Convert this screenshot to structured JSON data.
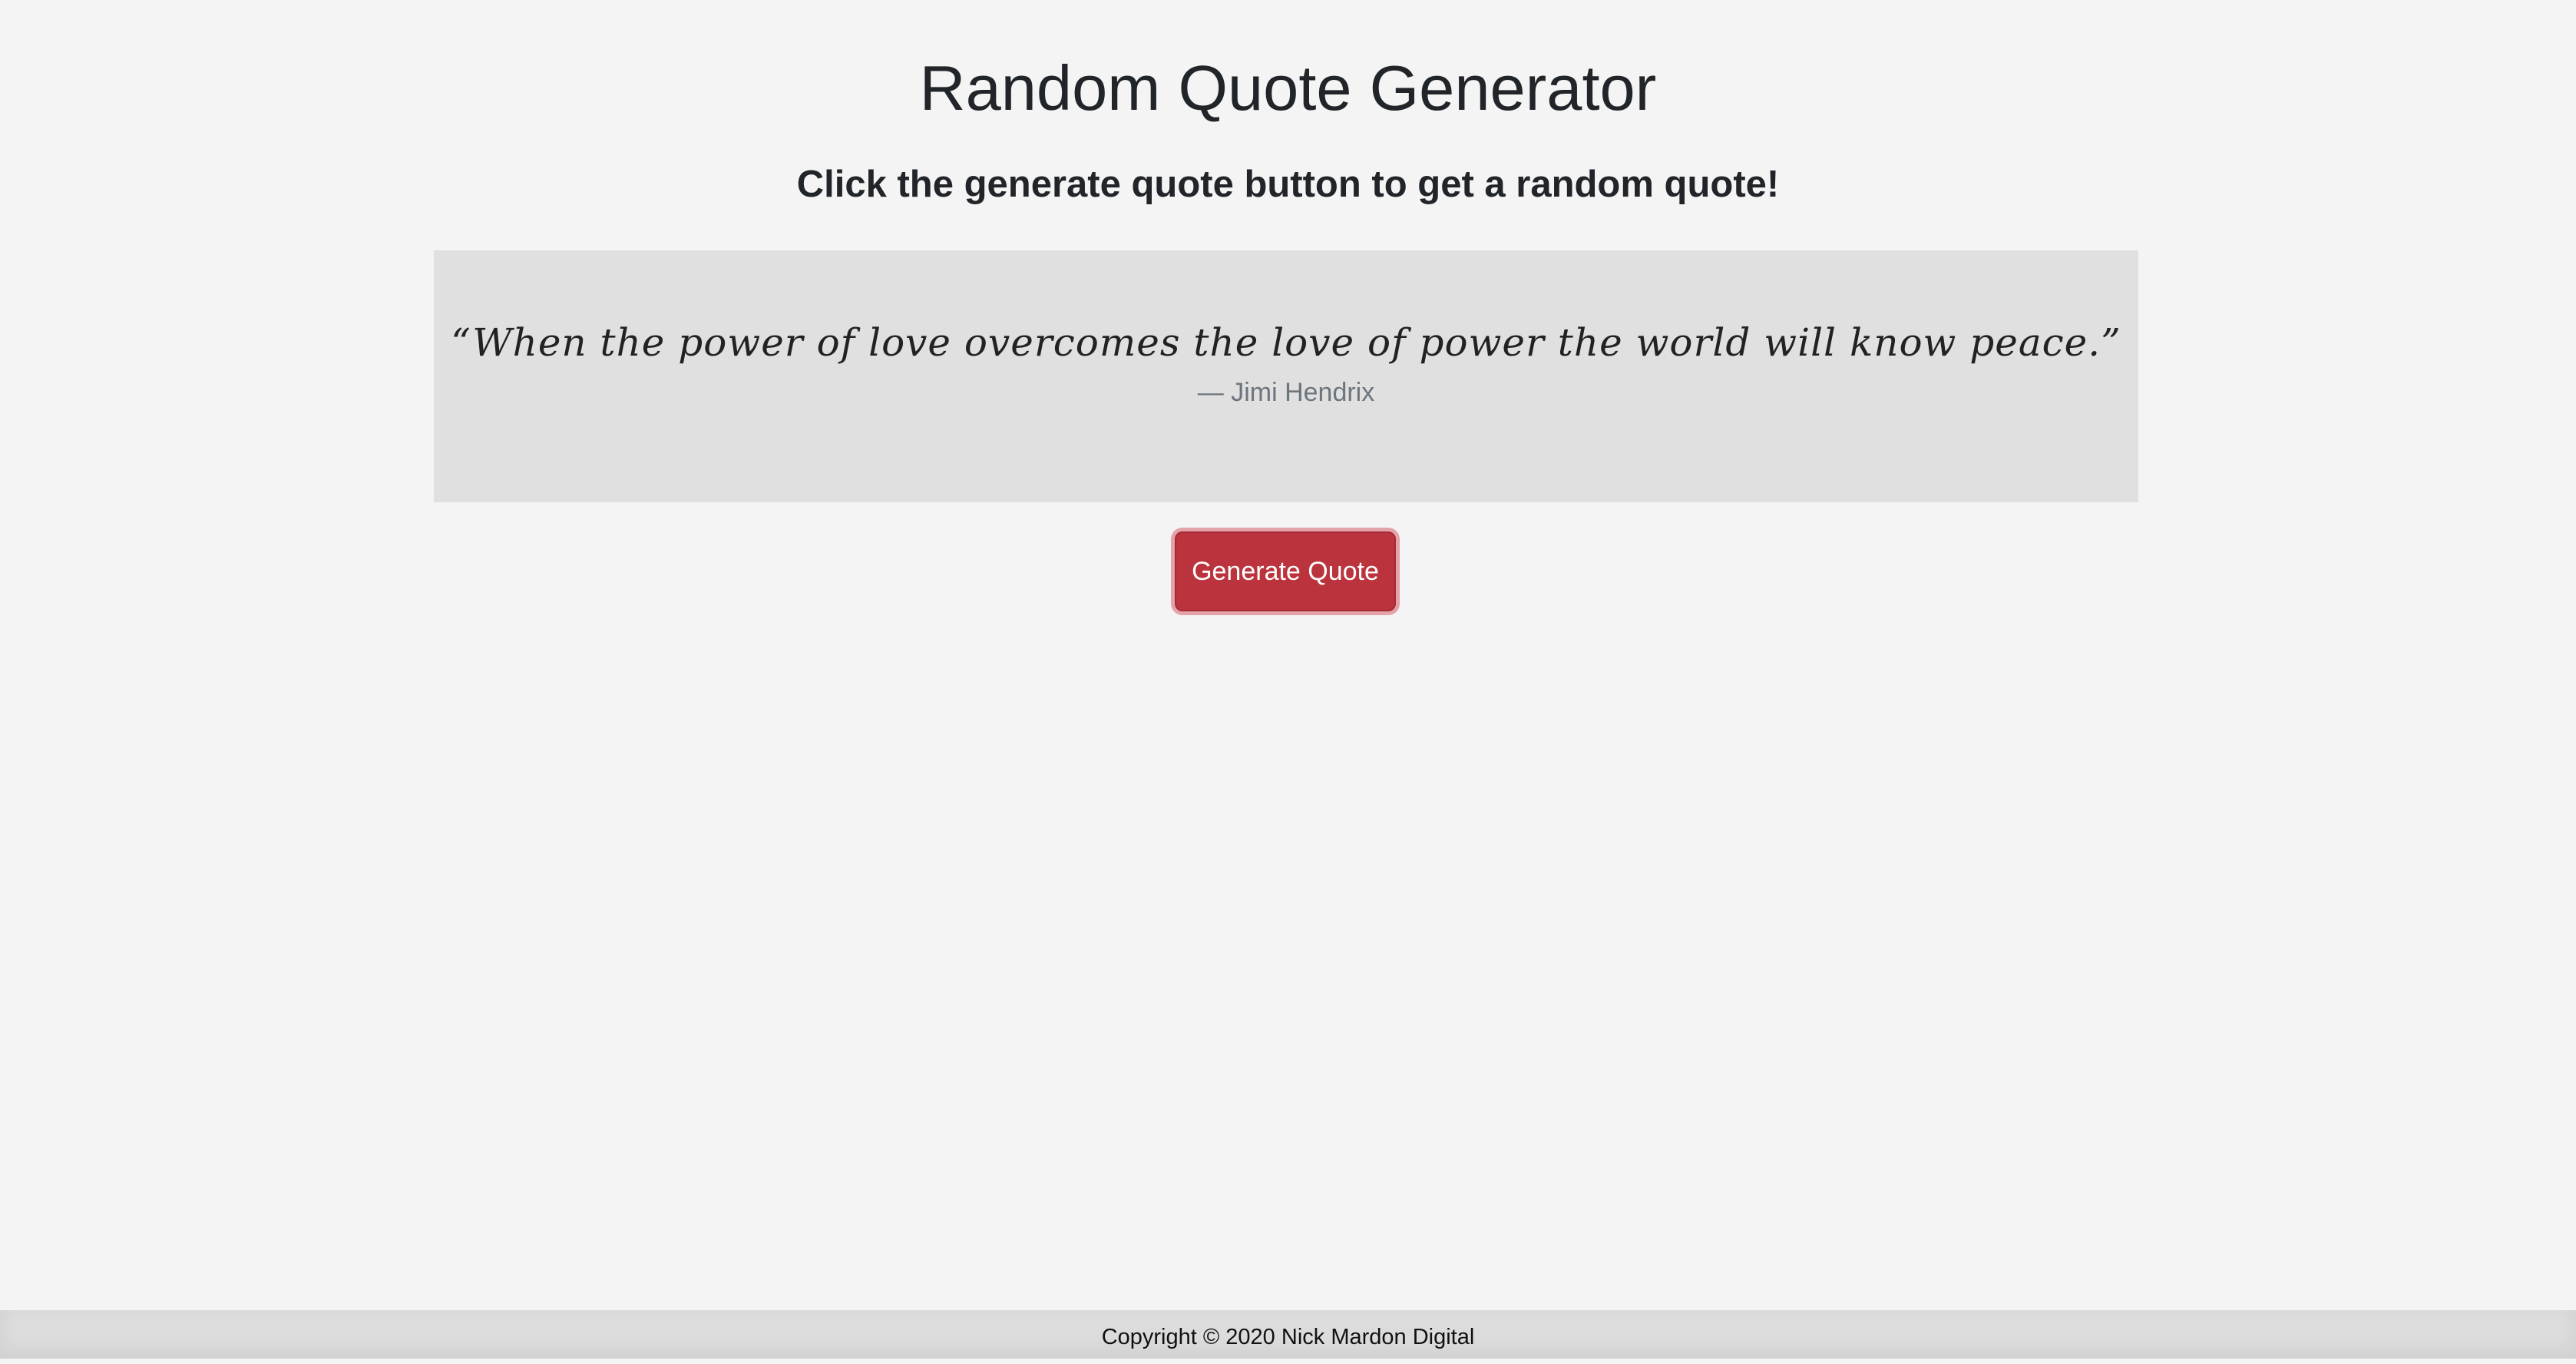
{
  "header": {
    "title": "Random Quote Generator",
    "subtitle": "Click the generate quote button to get a random quote!"
  },
  "quote": {
    "text": "“When the power of love overcomes the love of power the world will know peace.”",
    "author": "— Jimi Hendrix"
  },
  "actions": {
    "generate_label": "Generate Quote"
  },
  "footer": {
    "copyright": "Copyright © 2020 Nick Mardon Digital"
  },
  "colors": {
    "page_background": "#f4f4f4",
    "quote_box_background": "#e0e0e0",
    "button_background": "#bb333d",
    "button_text": "#ffffff",
    "author_text": "#6c757d",
    "footer_background": "#dcdcdc"
  }
}
